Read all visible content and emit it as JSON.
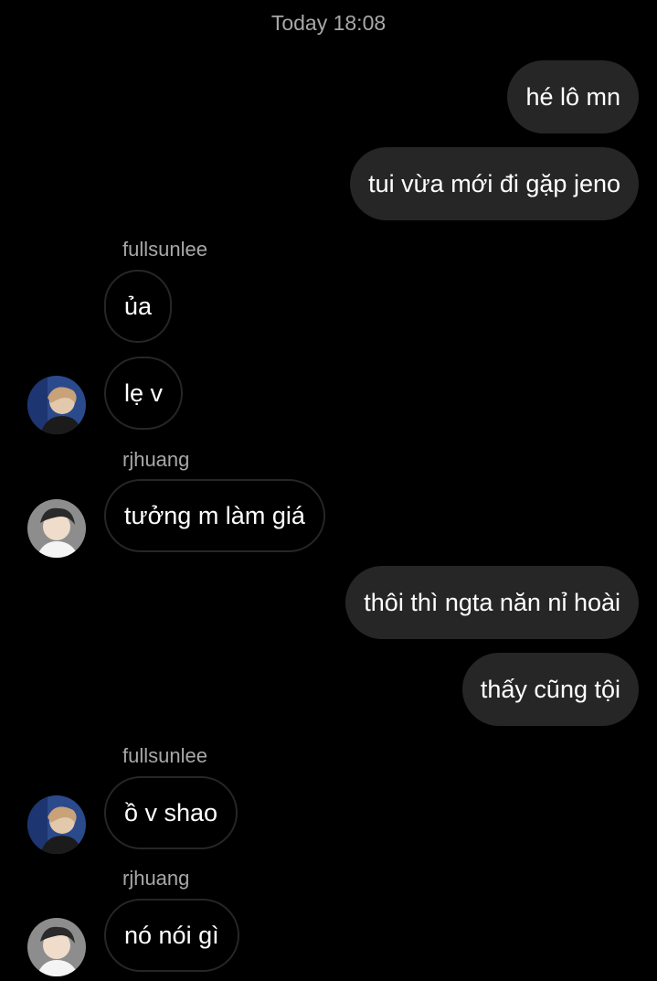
{
  "chat": {
    "timestamp": "Today 18:08",
    "messages": [
      {
        "direction": "out",
        "text": "hé lô mn"
      },
      {
        "direction": "out",
        "text": "tui vừa mới đi gặp jeno"
      },
      {
        "direction": "in",
        "sender": "fullsunlee",
        "text": "ủa"
      },
      {
        "direction": "in",
        "text": "lẹ v"
      },
      {
        "direction": "in",
        "sender": "rjhuang",
        "text": "tưởng m làm giá"
      },
      {
        "direction": "out",
        "text": "thôi thì ngta năn nỉ hoài"
      },
      {
        "direction": "out",
        "text": "thấy cũng tội"
      },
      {
        "direction": "in",
        "sender": "fullsunlee",
        "text": "ồ v shao"
      },
      {
        "direction": "in",
        "sender": "rjhuang",
        "text": "nó nói gì"
      }
    ]
  },
  "colors": {
    "background": "#000000",
    "outgoing_bubble": "#262626",
    "incoming_border": "#262626",
    "meta_text": "#a8a8a8"
  }
}
